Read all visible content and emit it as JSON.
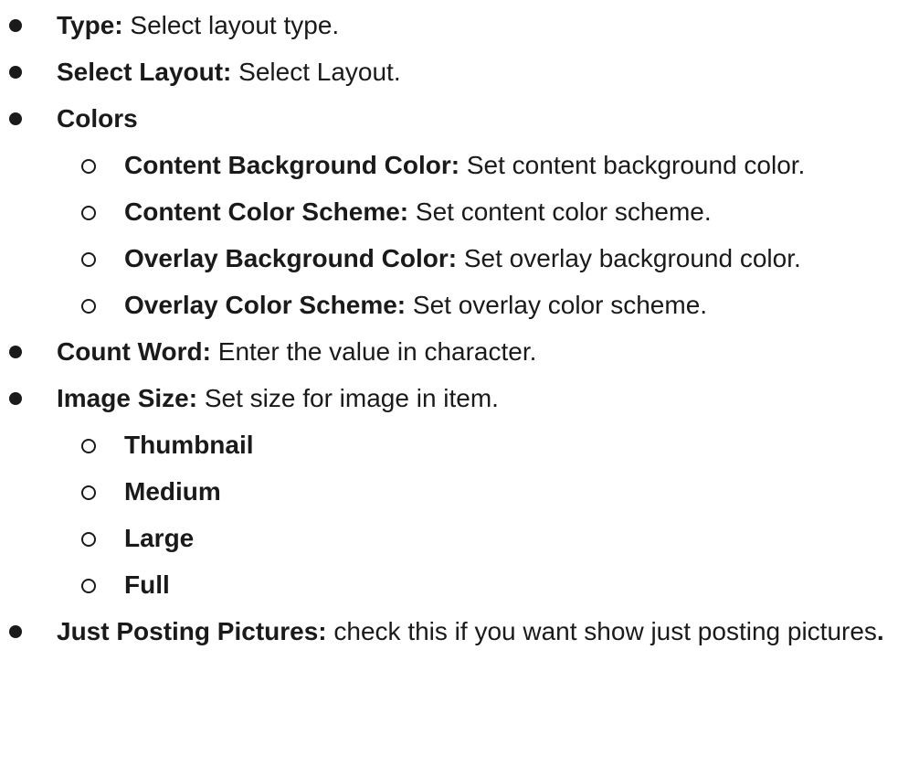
{
  "items": [
    {
      "term": "Type:",
      "desc": " Select layout type."
    },
    {
      "term": "Select Layout:",
      "desc": " Select Layout."
    },
    {
      "term": "Colors",
      "desc": "",
      "children": [
        {
          "term": "Content Background Color:",
          "desc": " Set content background color."
        },
        {
          "term": "Content Color Scheme:",
          "desc": " Set content color scheme."
        },
        {
          "term": "Overlay Background Color:",
          "desc": " Set overlay background color."
        },
        {
          "term": "Overlay Color Scheme:",
          "desc": " Set overlay color scheme."
        }
      ]
    },
    {
      "term": "Count Word:",
      "desc": " Enter the value in character."
    },
    {
      "term": "Image Size:",
      "desc": " Set size for image in item.",
      "children": [
        {
          "term": "Thumbnail",
          "desc": ""
        },
        {
          "term": "Medium",
          "desc": ""
        },
        {
          "term": "Large",
          "desc": ""
        },
        {
          "term": "Full",
          "desc": ""
        }
      ]
    },
    {
      "term": "Just Posting Pictures:",
      "desc": " check this if you want show just posting pictures",
      "end": "."
    }
  ]
}
